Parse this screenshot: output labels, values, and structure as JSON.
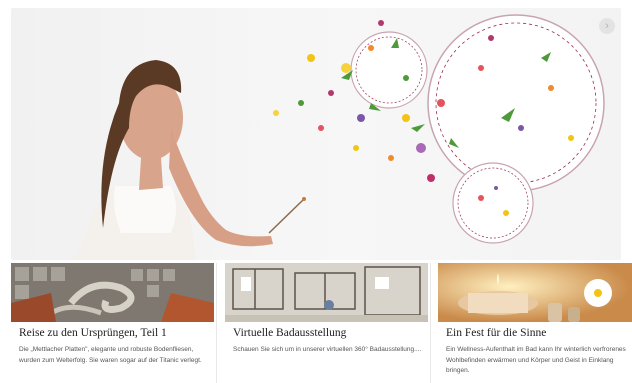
{
  "hero": {
    "next_icon": "›",
    "palette": {
      "background": "#f3f3f3",
      "plate_rim": "#9b2c4a",
      "skin": "#d9a48c",
      "hair": "#5a3a24"
    }
  },
  "cards": [
    {
      "title": "Reise zu den Ursprüngen, Teil 1",
      "text": "Die „Mettlacher Platten\", elegante und robuste Bodenfliesen, wurden zum Welterfolg. Sie waren sogar auf der Titanic verlegt.",
      "image": "tile-mosaic"
    },
    {
      "title": "Virtuelle Badausstellung",
      "text": "Schauen Sie sich um in unserer virtuellen 360° Badausstellung....",
      "image": "bathroom-floorplan"
    },
    {
      "title": "Ein Fest für die Sinne",
      "text": "Ein Wellness-Aufenthalt im Bad kann Ihr winterlich verfrorenes Wohlbefinden erwärmen und Körper und Geist in Einklang bringen.",
      "image": "candle-and-flower"
    }
  ]
}
